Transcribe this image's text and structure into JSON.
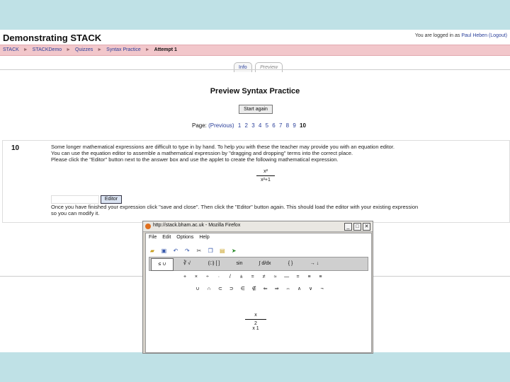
{
  "site": {
    "title": "Demonstrating STACK",
    "login_prefix": "You are logged in as",
    "login_user": "Paul Heben",
    "login_suffix": "(Logout)"
  },
  "breadcrumb": {
    "items": [
      "STACK",
      "STACKDemo",
      "Quizzes",
      "Syntax Practice"
    ],
    "separator": "►",
    "current": "Attempt 1"
  },
  "tabs": [
    "Info",
    "Preview"
  ],
  "quiz": {
    "title": "Preview Syntax Practice",
    "start_again": "Start again",
    "page_label": "Page:",
    "previous": "(Previous)",
    "pages": [
      "1",
      "2",
      "3",
      "4",
      "5",
      "6",
      "7",
      "8",
      "9"
    ],
    "current_page": "10"
  },
  "question": {
    "number": "10",
    "text_lines": [
      "Some longer mathematical expressions are difficult to type in by hand. To help you with these the teacher may provide you with an equation editor.",
      "You can use the equation editor to assemble a mathematical expression by \"dragging and dropping\" terms into the correct place.",
      "Please click the \"Editor\" button next to the answer box and use the applet to create the following mathematical expression."
    ],
    "fraction_num": "x²",
    "fraction_den": "x²+1",
    "answer_value": "",
    "editor_button": "Editor",
    "after_lines": [
      "Once you have finished your expression click \"save and close\". Then click the \"Editor\" button again. This should load the editor with your existing expression",
      "so you can modify it."
    ]
  },
  "popup": {
    "title": "http://stack.bham.ac.uk - Mozilla Firefox",
    "window_buttons": [
      "_",
      "□",
      "✕"
    ],
    "menu": [
      "File",
      "Edit",
      "Options",
      "Help"
    ],
    "toolbar_icons": [
      "open-folder-icon",
      "save-icon",
      "undo-icon",
      "redo-icon",
      "cut-icon",
      "copy-icon",
      "paste-icon",
      "export-icon"
    ],
    "palette": [
      "≤ ∪",
      "∛ √",
      "(□) [ ]",
      "sin",
      "∫ d/dx",
      "{ }",
      "→ ↓"
    ],
    "row1": [
      "+",
      "×",
      "÷",
      "·",
      "/",
      "±",
      "=",
      "≠",
      "≈",
      "—",
      "=",
      "≡",
      "≡"
    ],
    "row2": [
      "∪",
      "∩",
      "⊂",
      "⊃",
      "∈",
      "∉",
      "⇐",
      "⇒",
      "⇔",
      "∧",
      "∨",
      "¬"
    ],
    "frac_num": "x",
    "frac_mid": "2",
    "frac_den": "x    1"
  },
  "colors": {
    "accent": "#2a3f9a",
    "breadcrumb_bg": "#f2c7cb",
    "frame": "#bfe1e6"
  }
}
